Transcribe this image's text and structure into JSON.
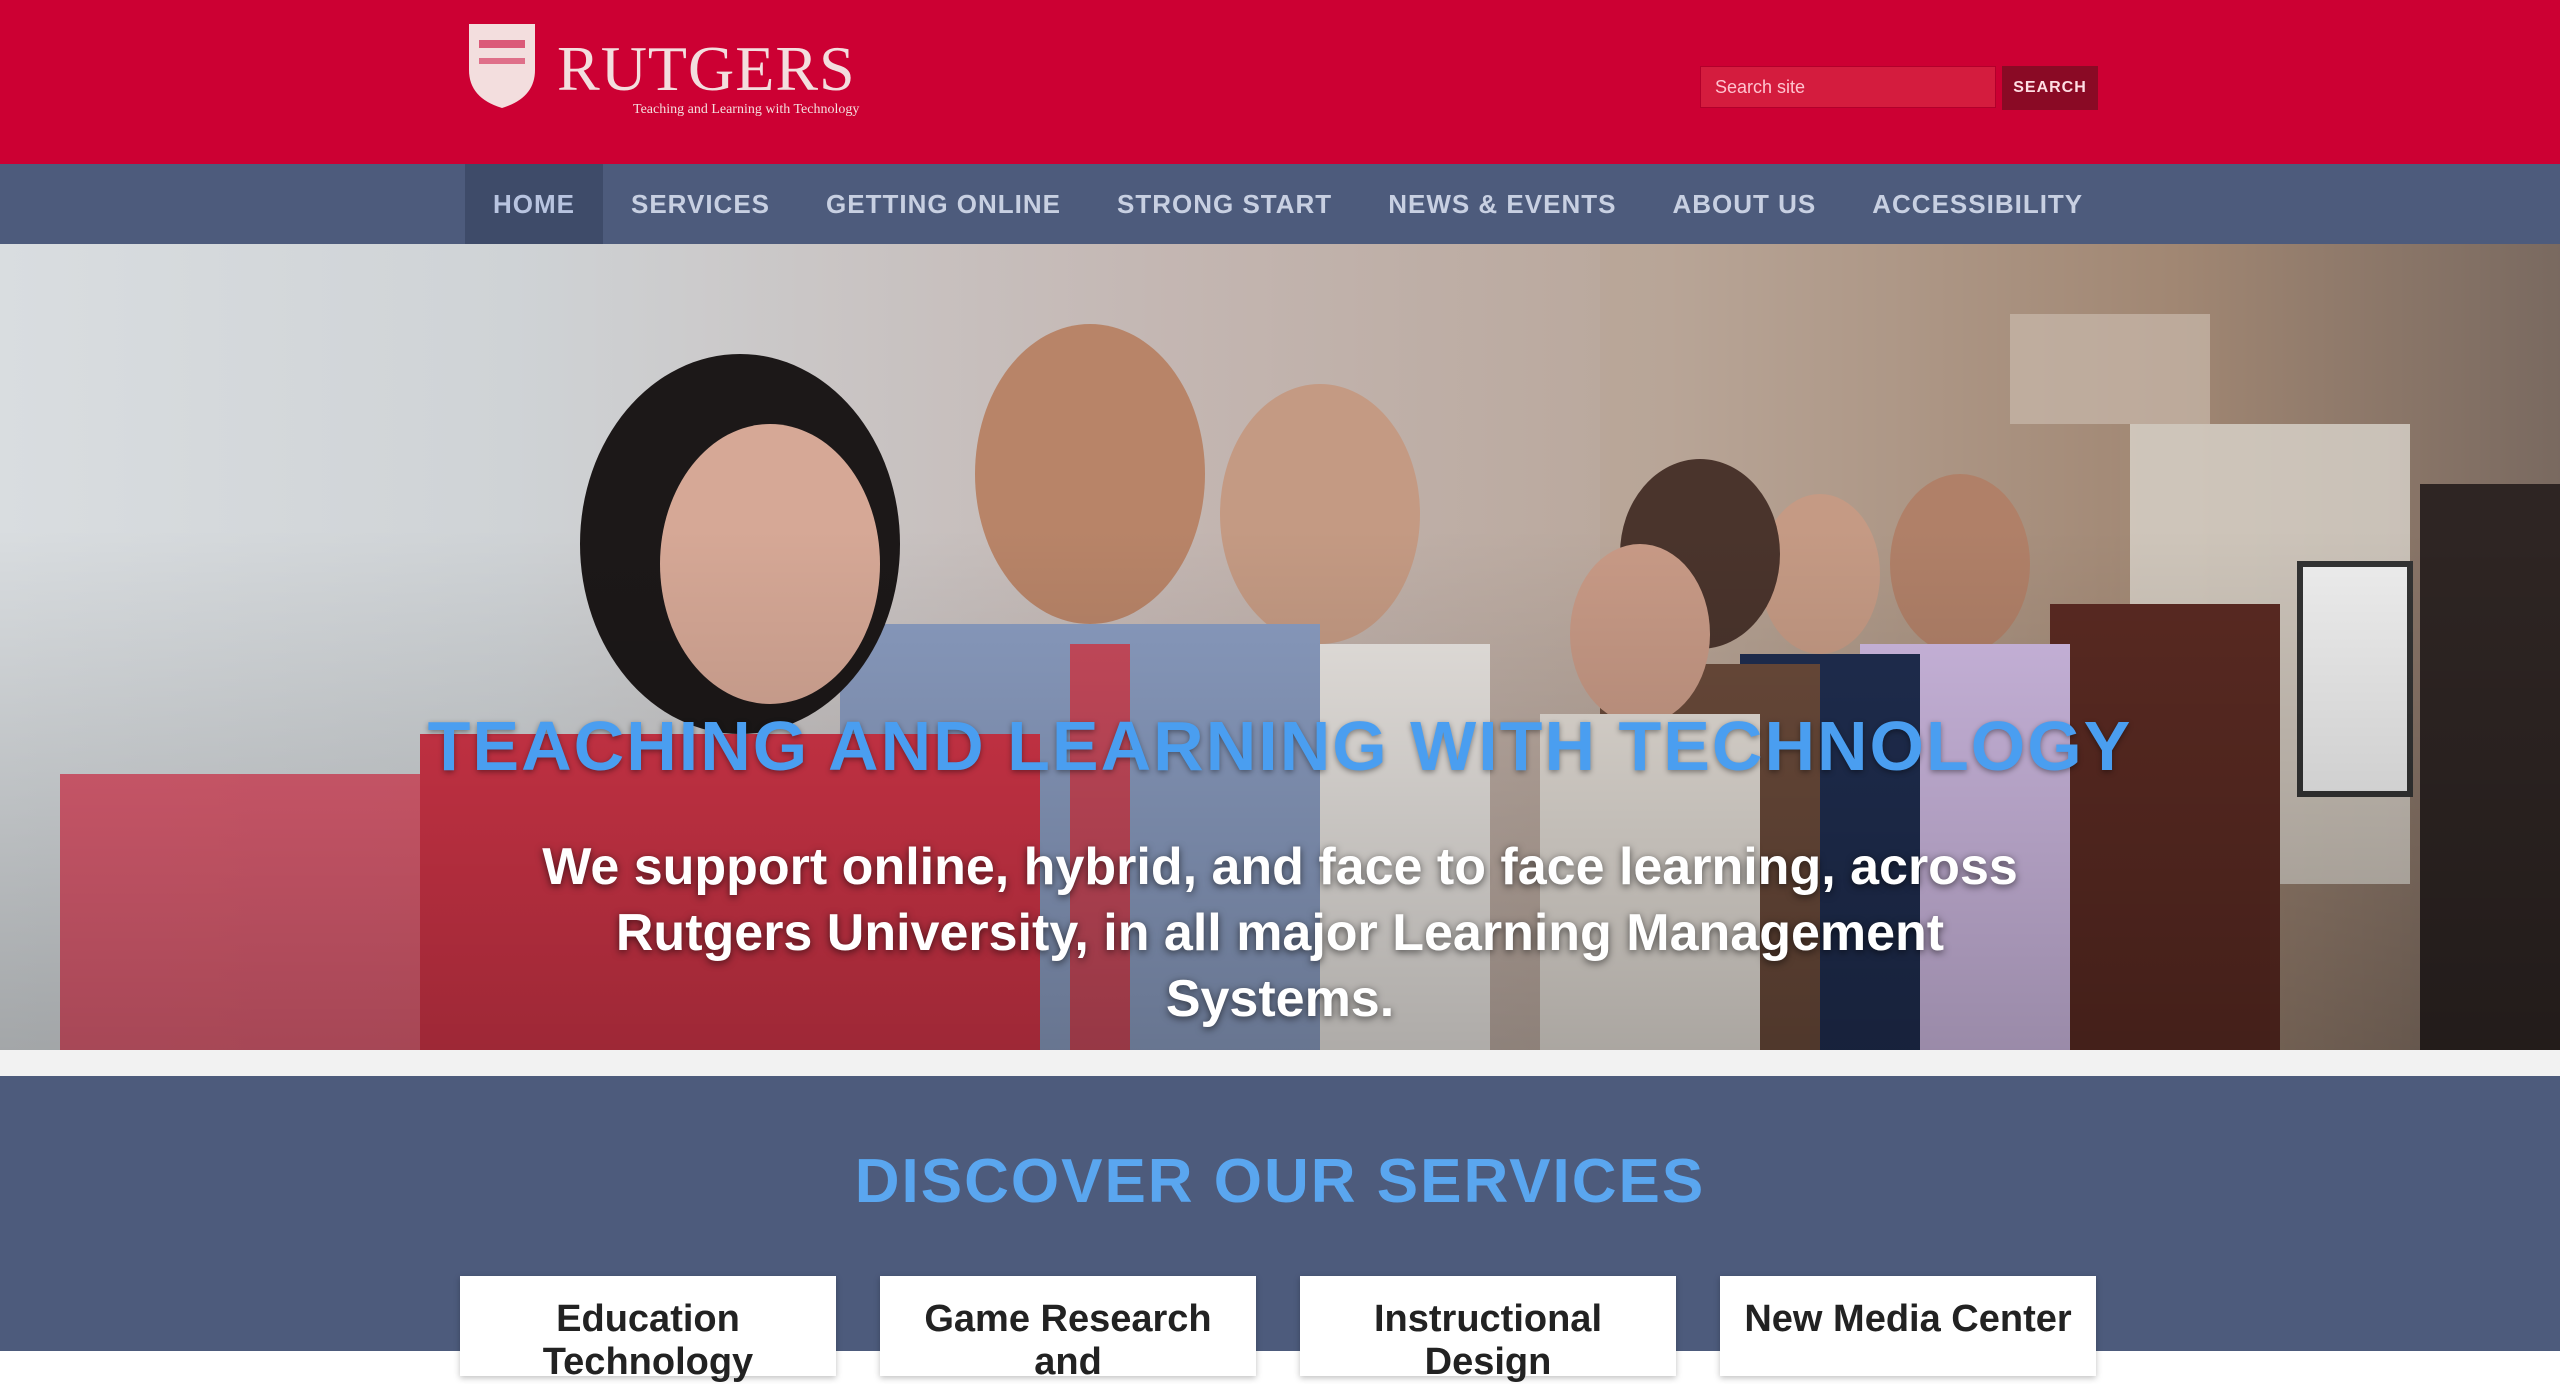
{
  "header": {
    "logo_text": "RUTGERS",
    "logo_subtext": "Teaching and Learning with Technology",
    "search": {
      "placeholder": "Search site",
      "button_label": "Search"
    }
  },
  "nav": {
    "items": [
      {
        "label": "Home",
        "active": true
      },
      {
        "label": "Services"
      },
      {
        "label": "Getting Online"
      },
      {
        "label": "Strong Start"
      },
      {
        "label": "News & Events"
      },
      {
        "label": "About Us"
      },
      {
        "label": "Accessibility"
      }
    ]
  },
  "hero": {
    "title": "Teaching and Learning with Technology",
    "subtitle": "We support online, hybrid, and face to face learning, across Rutgers University, in all major Learning Management Systems."
  },
  "services": {
    "heading": "Discover Our Services",
    "cards": [
      {
        "label": "Education Technology"
      },
      {
        "label": "Game Research and"
      },
      {
        "label": "Instructional Design"
      },
      {
        "label": "New Media Center"
      }
    ]
  },
  "colors": {
    "brand_red": "#cc0033",
    "nav_blue": "#4d5b7c",
    "accent_blue": "#5aa6ef"
  }
}
